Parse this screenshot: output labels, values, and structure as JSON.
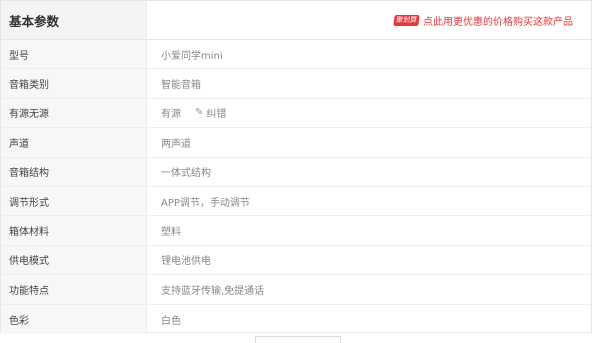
{
  "header": {
    "title": "基本参数",
    "promo_badge": "聚划算",
    "promo_text": "点此用更优惠的价格购买这款产品",
    "accent_color": "#e4393c"
  },
  "params": [
    {
      "label": "型号",
      "value": "小爱同学mini"
    },
    {
      "label": "音箱类别",
      "value": "智能音箱"
    },
    {
      "label": "有源无源",
      "value": "有源",
      "correct_label": "纠错",
      "correct_icon": "pencil-icon"
    },
    {
      "label": "声道",
      "value": "两声道"
    },
    {
      "label": "音箱结构",
      "value": "一体式结构"
    },
    {
      "label": "调节形式",
      "value": "APP调节，手动调节"
    },
    {
      "label": "箱体材料",
      "value": "塑料"
    },
    {
      "label": "供电模式",
      "value": "锂电池供电"
    },
    {
      "label": "功能特点",
      "value": "支持蓝牙传输,免提通话"
    },
    {
      "label": "色彩",
      "value": "白色"
    }
  ]
}
